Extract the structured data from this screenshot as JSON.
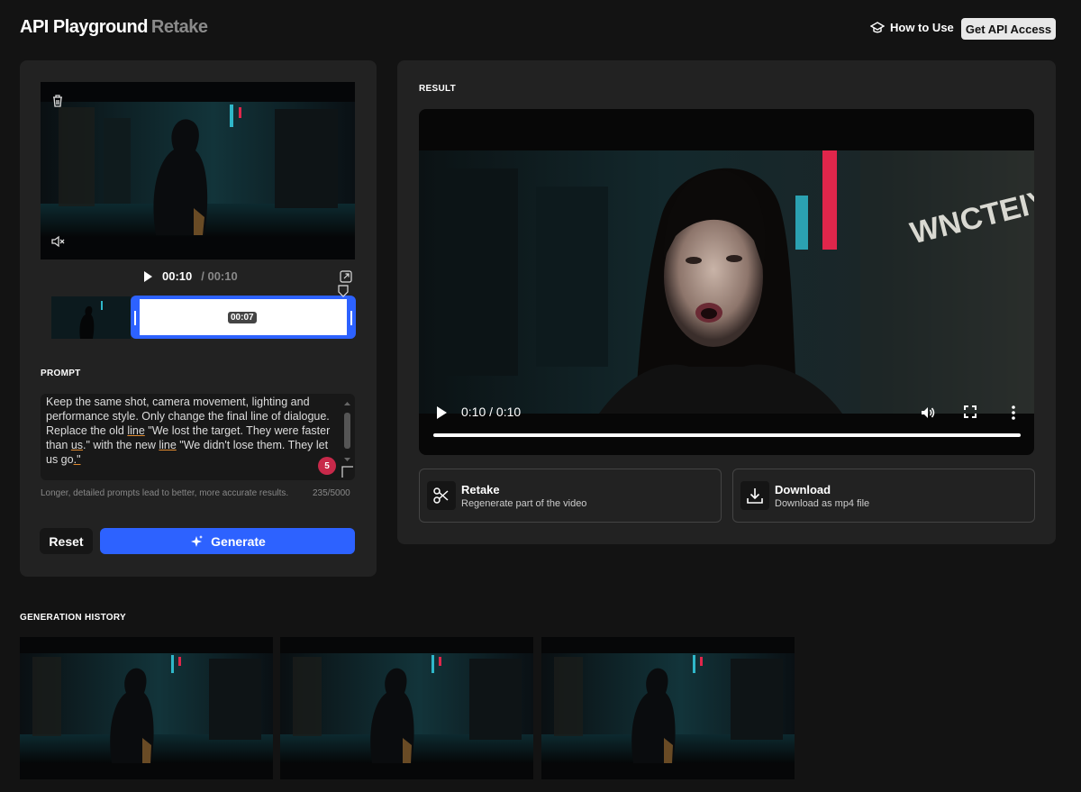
{
  "header": {
    "title": "API Playground",
    "subtitle": "Retake",
    "how_to_label": "How to Use",
    "api_access_label": "Get API Access"
  },
  "source": {
    "current_time": "00:10",
    "total_time": "/ 00:10",
    "selection_badge": "00:07"
  },
  "prompt": {
    "section_label": "PROMPT",
    "text_parts": [
      "Keep the same shot, camera movement, lighting and performance style. Only change the final line of dialogue. Replace the old ",
      "line",
      " \"We lost the target. They were faster than ",
      "us",
      ".\" with the new ",
      "line",
      " \"We didn't lose them. They let us go",
      ".\""
    ],
    "issue_count": "5",
    "hint": "Longer, detailed prompts lead to better, more accurate results.",
    "char_count": "235/5000"
  },
  "buttons": {
    "reset_label": "Reset",
    "generate_label": "Generate"
  },
  "result": {
    "section_label": "RESULT",
    "time": "0:10 / 0:10",
    "progress": 1.0,
    "sign_text": "WNCTEIY UN"
  },
  "actions": [
    {
      "title": "Retake",
      "subtitle": "Regenerate part of the video",
      "icon": "scissors-icon"
    },
    {
      "title": "Download",
      "subtitle": "Download as mp4 file",
      "icon": "download-icon"
    }
  ],
  "history": {
    "section_label": "GENERATION HISTORY",
    "items": [
      "history-1",
      "history-2",
      "history-3"
    ]
  },
  "colors": {
    "accent": "#2d62ff",
    "badge": "#c8294a",
    "neon_teal": "#2fb7c9",
    "neon_red": "#e0264b"
  }
}
